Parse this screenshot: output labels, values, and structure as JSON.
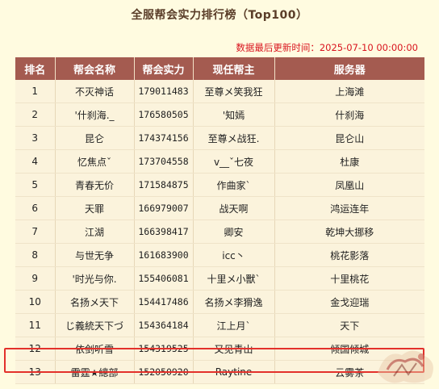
{
  "page": {
    "title": "全服帮会实力排行榜（Top100）",
    "update_time": "数据最后更新时间：2025-07-10 00:00:00"
  },
  "table": {
    "headers": [
      "排名",
      "帮会名称",
      "帮会实力",
      "现任帮主",
      "服务器"
    ],
    "rows": [
      {
        "rank": "1",
        "guild": "不灭神话",
        "power": "179011483",
        "leader": "至尊メ笑我狂",
        "server": "上海滩"
      },
      {
        "rank": "2",
        "guild": "'什刹海._",
        "power": "176580505",
        "leader": "'知嫣",
        "server": "什刹海"
      },
      {
        "rank": "3",
        "guild": "昆仑",
        "power": "174374156",
        "leader": "至尊メ战狂.",
        "server": "昆仑山"
      },
      {
        "rank": "4",
        "guild": "忆焦点ˇ",
        "power": "173704558",
        "leader": "v__ˇ七夜",
        "server": "杜康"
      },
      {
        "rank": "5",
        "guild": "青春无价",
        "power": "171584875",
        "leader": "作曲家`",
        "server": "凤凰山"
      },
      {
        "rank": "6",
        "guild": "天罪",
        "power": "166979007",
        "leader": "战天啊",
        "server": "鸿运连年"
      },
      {
        "rank": "7",
        "guild": "江湖",
        "power": "166398417",
        "leader": "卿安",
        "server": "乾坤大挪移"
      },
      {
        "rank": "8",
        "guild": "与世无争",
        "power": "161683900",
        "leader": "icc丶",
        "server": "桃花影落"
      },
      {
        "rank": "9",
        "guild": "'时光与你.",
        "power": "155406081",
        "leader": "十里メ小獸`",
        "server": "十里桃花"
      },
      {
        "rank": "10",
        "guild": "名扬メ天下",
        "power": "154417486",
        "leader": "名扬メ李猾逸",
        "server": "金戈迎瑞"
      },
      {
        "rank": "11",
        "guild": "じ義統天下づ",
        "power": "154364184",
        "leader": "江上月`",
        "server": "天下"
      },
      {
        "rank": "12",
        "guild": "依剑听雪",
        "power": "154319525",
        "leader": "又见青山",
        "server": "倾国倾城"
      },
      {
        "rank": "13",
        "guild": "雷霆★總部",
        "power": "152050920",
        "leader": "Raytine",
        "server": "云雾茶"
      }
    ],
    "highlighted_rank": "13"
  },
  "colors": {
    "header_bg": "#a45b50",
    "row_bg": "#fbf3dc",
    "page_bg": "#fffbe0",
    "update_text": "#d9141e",
    "highlight_border": "#e3312b"
  },
  "icons": {
    "watermark": "game-logo-watermark"
  }
}
